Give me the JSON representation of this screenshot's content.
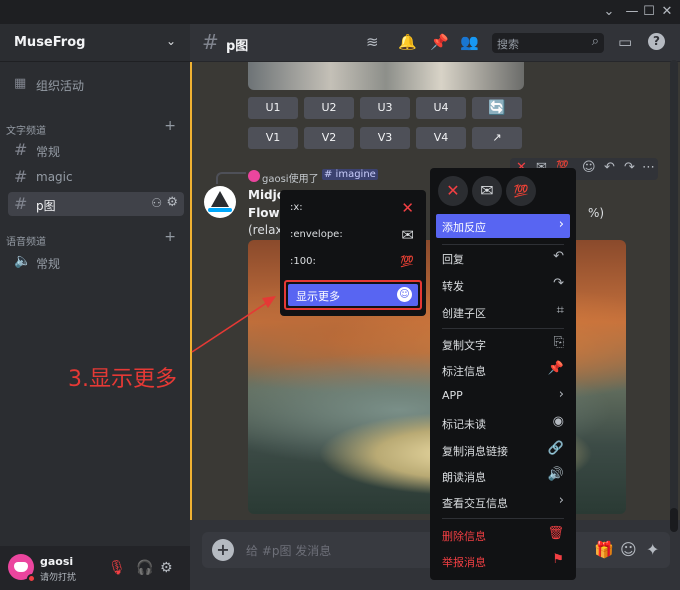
{
  "window": {
    "buttons": [
      "⌄",
      "—",
      "☐",
      "✕"
    ]
  },
  "server": {
    "name": "MuseFrog"
  },
  "sidebar": {
    "events_label": "组织活动",
    "text_category": "文字频道",
    "voice_category": "语音频道",
    "text_channels": [
      {
        "label": "常规"
      },
      {
        "label": "magic"
      },
      {
        "label": "p图"
      }
    ],
    "voice_channels": [
      {
        "label": "常规"
      }
    ]
  },
  "user": {
    "name": "gaosi",
    "status": "请勿打扰"
  },
  "header": {
    "channel": "p图",
    "search_placeholder": "搜索"
  },
  "mj_buttons": {
    "row1": [
      "U1",
      "U2",
      "U3",
      "U4"
    ],
    "row2": [
      "V1",
      "V2",
      "V3",
      "V4"
    ]
  },
  "message": {
    "reply_user": "gaosi使用了",
    "reply_command": "# imagine",
    "bot_name": "Midjo",
    "line2": "Flowi",
    "line3": "(relax",
    "pct_tail": "%)"
  },
  "emoji_popup": {
    "items": [
      {
        "name": ":x:",
        "glyph": "✕"
      },
      {
        "name": ":envelope:",
        "glyph": "✉"
      },
      {
        "name": ":100:",
        "glyph": "💯"
      }
    ],
    "show_more": "显示更多"
  },
  "context_menu": {
    "reactions": [
      "✕",
      "✉",
      "💯"
    ],
    "items": [
      {
        "label": "添加反应",
        "icon": "›"
      },
      {
        "label": "回复",
        "icon": "↶"
      },
      {
        "label": "转发",
        "icon": "↷"
      },
      {
        "label": "创建子区",
        "icon": "⌗"
      },
      {
        "label": "复制文字",
        "icon": "⎘"
      },
      {
        "label": "标注信息",
        "icon": "📌"
      },
      {
        "label": "APP",
        "icon": "›"
      },
      {
        "label": "标记未读",
        "icon": "◉"
      },
      {
        "label": "复制消息链接",
        "icon": "🔗"
      },
      {
        "label": "朗读消息",
        "icon": "🔊"
      },
      {
        "label": "查看交互信息",
        "icon": "›"
      },
      {
        "label": "删除信息",
        "icon": "🗑"
      },
      {
        "label": "举报消息",
        "icon": "⚑"
      }
    ]
  },
  "input": {
    "placeholder": "给 #p图 发消息"
  },
  "annotation": {
    "text": "3.显示更多"
  },
  "colors": {
    "accent": "#5865f2",
    "danger": "#f23f43",
    "highlight_border": "#e53935",
    "mention": "#f0b232"
  }
}
